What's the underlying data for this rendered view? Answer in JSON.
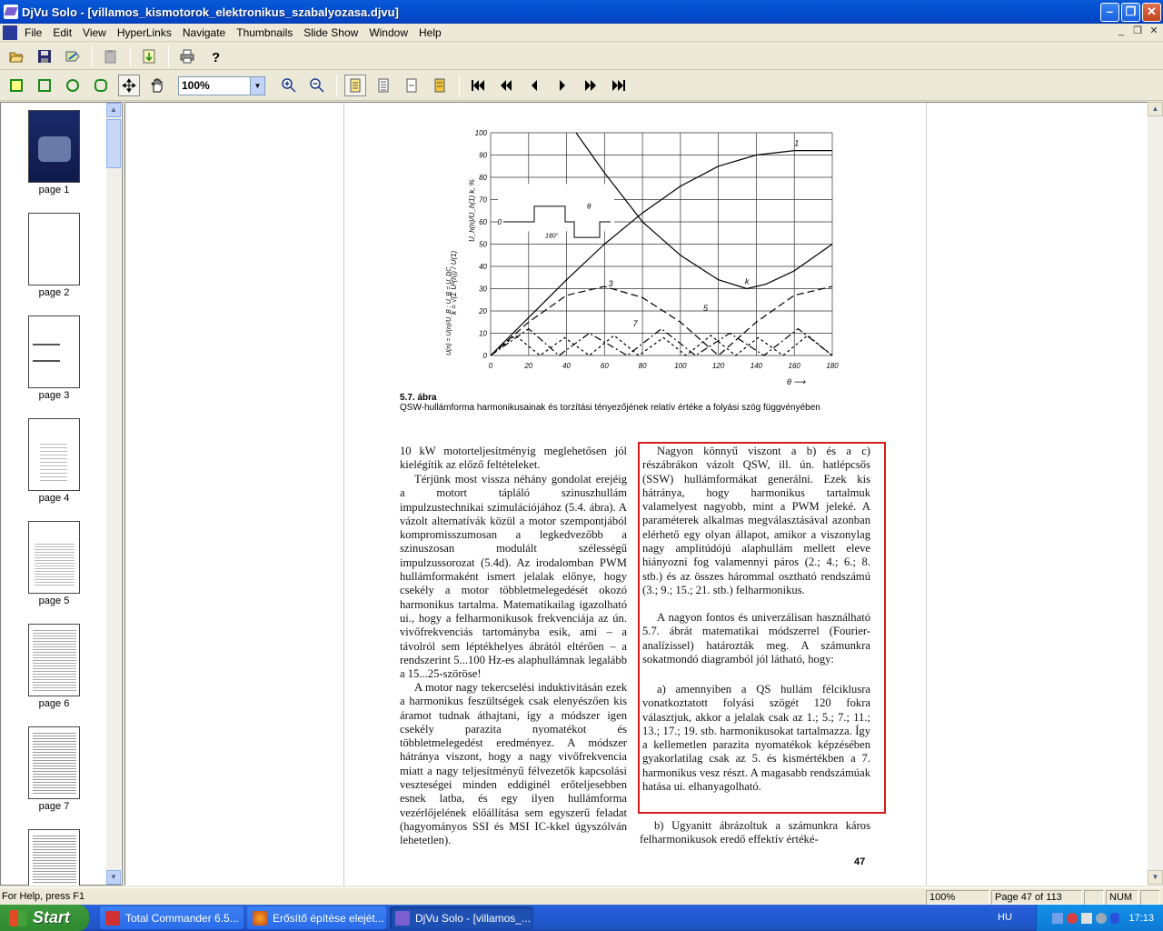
{
  "window": {
    "title": "DjVu Solo - [villamos_kismotorok_elektronikus_szabalyozasa.djvu]"
  },
  "menu": {
    "items": [
      "File",
      "Edit",
      "View",
      "HyperLinks",
      "Navigate",
      "Thumbnails",
      "Slide Show",
      "Window",
      "Help"
    ]
  },
  "toolbar": {
    "zoom_value": "100%"
  },
  "thumbnails": {
    "items": [
      "page 1",
      "page 2",
      "page 3",
      "page 4",
      "page 5",
      "page 6",
      "page 7"
    ]
  },
  "page": {
    "figure_caption_title": "5.7. ábra",
    "figure_caption_text": "QSW-hullámforma harmonikusainak és torzítási tényezőjének relatív értéke a folyási szög függvényében",
    "page_number": "47",
    "left_column": [
      "10 kW motorteljesítményig meglehetősen jól kielégítik az előző feltételeket.",
      "Térjünk most vissza néhány gondolat erejéig a motort tápláló szinuszhullám impulzustechnikai szimulációjához (5.4. ábra). A vázolt alternatívák közül a motor szempontjából kompromisszumosan a legkedvezőbb a szinuszosan modulált szélességű impulzussorozat (5.4d). Az irodalomban PWM hullámformaként ismert jelalak előnye, hogy csekély a motor többletmelegedését okozó harmonikus tartalma. Matematikailag igazolható ui., hogy a felharmonikusok frekvenciája az ún. vivőfrekvenciás tartományba esik, ami – a távolról sem léptékhelyes ábrától eltérően – a rendszerint 5...100 Hz-es alaphullámnak legalább a 15...25-szöröse!",
      "A motor nagy tekercselési induktivitásán ezek a harmonikus feszültségek csak elenyészően kis áramot tudnak áthajtani, így a módszer igen csekély parazita nyomatékot és többletmelegedést eredményez. A módszer hátránya viszont, hogy a nagy vivőfrekvencia miatt a nagy teljesítményű félvezetők kapcsolási veszteségei minden eddiginél erőteljesebben esnek latba, és egy ilyen hullámforma vezérlőjelének előállítása sem egyszerű feladat (hagyományos SSI és MSI IC-kkel úgyszólván lehetetlen)."
    ],
    "right_column": [
      "Nagyon könnyű viszont a b) és a c) részábrákon vázolt QSW, ill. ún. hatlépcsős (SSW) hullámformákat generálni. Ezek kis hátránya, hogy harmonikus tartalmuk valamelyest nagyobb, mint a PWM jeleké. A paraméterek alkalmas megválasztásával azonban elérhető egy olyan állapot, amikor a viszonylag nagy amplitúdójú alaphullám mellett eleve hiányozni fog valamennyi páros (2.; 4.; 6.; 8. stb.) és az összes hárommal osztható rendszámú (3.; 9.; 15.; 21. stb.) felharmonikus.",
      "A nagyon fontos és univerzálisan használható 5.7. ábrát matematikai módszerrel (Fourier-analízissel) határozták meg. A számunkra sokatmondó diagramból jól látható, hogy:",
      "a) amennyiben a QS hullám félciklusra vonatkoztatott folyási szögét 120 fokra választjuk, akkor a jelalak csak az 1.; 5.; 7.; 11.; 13.; 17.; 19. stb. harmonikusokat tartalmazza. Így a kellemetlen parazita nyomatékok képzésében gyakorlatilag csak az 5. és kismértékben a 7. harmonikus vesz részt. A magasabb rendszámúak hatása ui. elhanyagolható.",
      "b) Ugyanitt ábrázoltuk a számunkra káros felharmonikusok eredő effektív értéké-"
    ]
  },
  "chart_data": {
    "type": "line",
    "xlabel": "θ",
    "ylabel": "U_h(n)/U_h(1) k, %",
    "xticks": [
      0,
      20,
      40,
      60,
      80,
      100,
      120,
      140,
      160,
      180
    ],
    "yticks": [
      0,
      10,
      20,
      30,
      40,
      50,
      60,
      70,
      80,
      90,
      100
    ],
    "xlim": [
      0,
      180
    ],
    "ylim": [
      0,
      100
    ],
    "series": [
      {
        "name": "1",
        "x": [
          0,
          20,
          40,
          60,
          80,
          100,
          120,
          140,
          160,
          180
        ],
        "y": [
          0,
          17,
          34,
          50,
          64,
          76,
          85,
          90,
          92,
          92
        ]
      },
      {
        "name": "k",
        "x": [
          45,
          60,
          80,
          100,
          120,
          135,
          145,
          160,
          180
        ],
        "y": [
          100,
          82,
          60,
          45,
          34,
          30,
          32,
          38,
          50
        ]
      },
      {
        "name": "3",
        "x": [
          0,
          20,
          40,
          60,
          80,
          100,
          120,
          140,
          160,
          180
        ],
        "y": [
          0,
          15,
          27,
          31,
          26,
          15,
          0,
          15,
          27,
          31
        ]
      },
      {
        "name": "5",
        "x": [
          0,
          20,
          36,
          52,
          72,
          90,
          108,
          126,
          144,
          162,
          180
        ],
        "y": [
          0,
          12,
          0,
          10,
          0,
          12,
          0,
          10,
          0,
          12,
          0
        ]
      },
      {
        "name": "7",
        "x": [
          0,
          13,
          26,
          39,
          52,
          65,
          78,
          91,
          103,
          116,
          129,
          141,
          154,
          167,
          180
        ],
        "y": [
          0,
          9,
          0,
          8,
          0,
          9,
          0,
          8,
          0,
          9,
          0,
          8,
          0,
          9,
          0
        ]
      }
    ],
    "label_1": "1",
    "label_k": "k",
    "label_3": "3",
    "label_5": "5",
    "label_7": "7",
    "k_formula": "k = √(Σ U²(n)) / U(1)",
    "inset_label_zero": "0",
    "inset_label_180": "180°",
    "inset_label_theta": "θ",
    "left_label": "U(n) = U(n)/U_B ;   U_B = U_DC"
  },
  "status": {
    "help": "For Help, press F1",
    "zoom": "100%",
    "page": "Page 47 of 113",
    "num": "NUM"
  },
  "taskbar": {
    "start": "Start",
    "tasks": [
      "Total Commander 6.5...",
      "Erősítő építése elejét...",
      "DjVu Solo - [villamos_..."
    ],
    "lang": "HU",
    "clock": "17:13"
  }
}
